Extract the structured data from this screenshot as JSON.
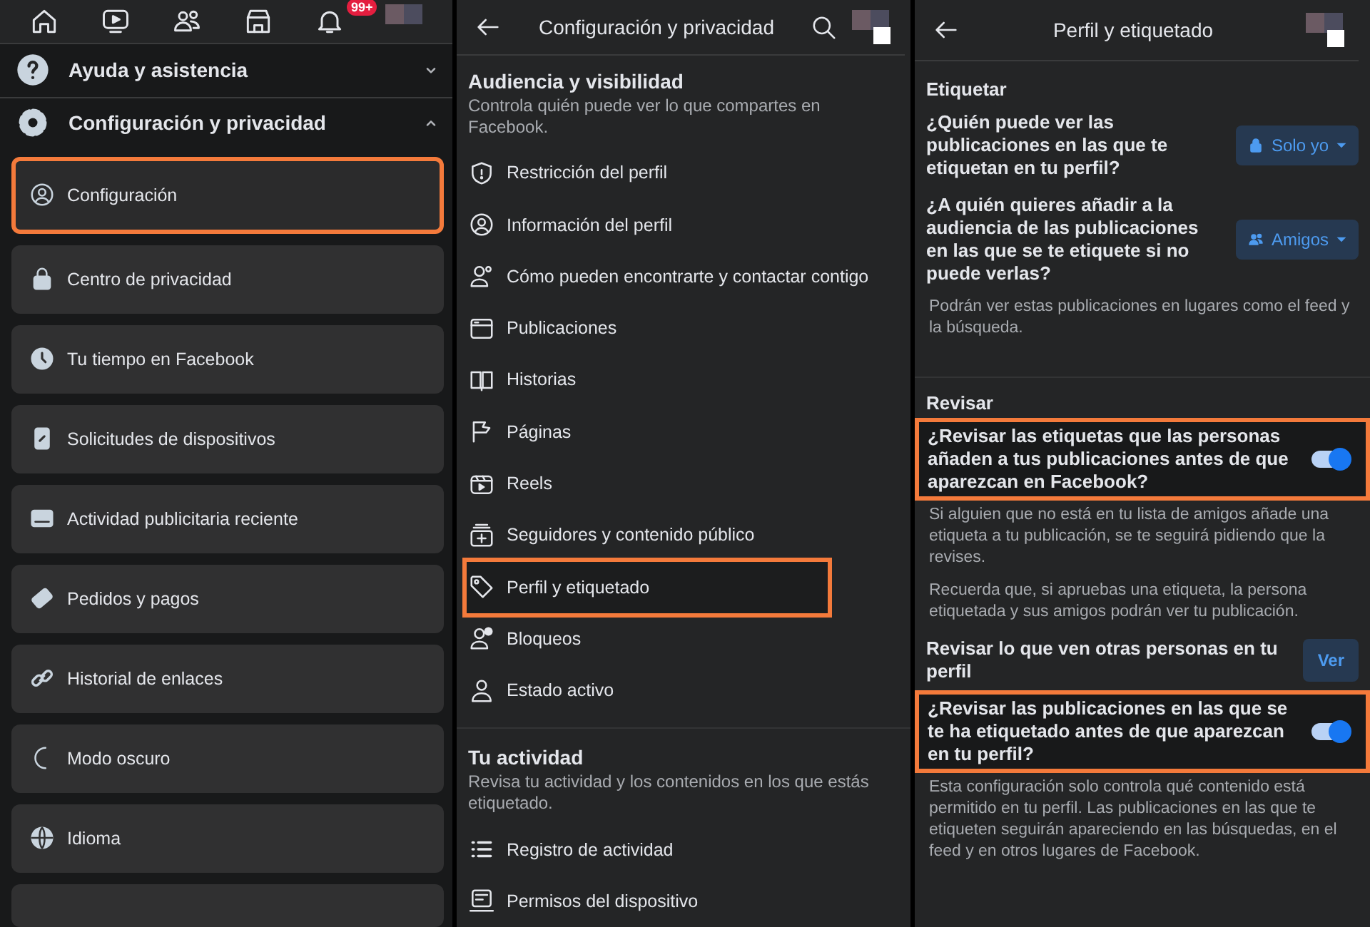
{
  "menu_screen": {
    "nav_tabs": [
      {
        "kind": "home"
      },
      {
        "kind": "video"
      },
      {
        "kind": "friends"
      },
      {
        "kind": "store"
      },
      {
        "kind": "bell",
        "badge": "99+"
      },
      {
        "kind": "avatar"
      }
    ],
    "sections": [
      {
        "kind": "question",
        "label": "Ayuda y asistencia",
        "expanded": false
      },
      {
        "kind": "gear",
        "label": "Configuración y privacidad",
        "expanded": true
      }
    ],
    "items": [
      {
        "kind": "user-circle",
        "label": "Configuración",
        "highlighted": true
      },
      {
        "kind": "lock",
        "label": "Centro de privacidad",
        "highlighted": false
      },
      {
        "kind": "clock",
        "label": "Tu tiempo en Facebook",
        "highlighted": false
      },
      {
        "kind": "phone",
        "label": "Solicitudes de dispositivos",
        "highlighted": false
      },
      {
        "kind": "ad",
        "label": "Actividad publicitaria reciente",
        "highlighted": false
      },
      {
        "kind": "card",
        "label": "Pedidos y pagos",
        "highlighted": false
      },
      {
        "kind": "link",
        "label": "Historial de enlaces",
        "highlighted": false
      },
      {
        "kind": "moon",
        "label": "Modo oscuro",
        "highlighted": false
      },
      {
        "kind": "globe",
        "label": "Idioma",
        "highlighted": false
      }
    ]
  },
  "settings_screen": {
    "title": "Configuración y privacidad",
    "groups": [
      {
        "title": "Audiencia y visibilidad",
        "description": "Controla quién puede ver lo que compartes en Facebook.",
        "items": [
          {
            "kind": "shield",
            "label": "Restricción del perfil",
            "highlighted": false
          },
          {
            "kind": "user-circle",
            "label": "Información del perfil",
            "highlighted": false
          },
          {
            "kind": "user-search",
            "label": "Cómo pueden encontrarte y contactar contigo",
            "highlighted": false
          },
          {
            "kind": "window",
            "label": "Publicaciones",
            "highlighted": false
          },
          {
            "kind": "book",
            "label": "Historias",
            "highlighted": false
          },
          {
            "kind": "flag",
            "label": "Páginas",
            "highlighted": false
          },
          {
            "kind": "play",
            "label": "Reels",
            "highlighted": false
          },
          {
            "kind": "plus-box",
            "label": "Seguidores y contenido público",
            "highlighted": false
          },
          {
            "kind": "tag",
            "label": "Perfil y etiquetado",
            "highlighted": true
          },
          {
            "kind": "user-block",
            "label": "Bloqueos",
            "highlighted": false
          },
          {
            "kind": "person",
            "label": "Estado activo",
            "highlighted": false
          }
        ]
      },
      {
        "title": "Tu actividad",
        "description": "Revisa tu actividad y los contenidos en los que estás etiquetado.",
        "items": [
          {
            "kind": "list",
            "label": "Registro de actividad",
            "highlighted": false
          },
          {
            "kind": "device",
            "label": "Permisos del dispositivo",
            "highlighted": false
          }
        ]
      }
    ]
  },
  "tagging_screen": {
    "title": "Perfil y etiquetado",
    "sections": [
      {
        "title": "Etiquetar",
        "rows": [
          {
            "kind": "dropdown",
            "question": "¿Quién puede ver las publicaciones en las que te etiquetan en tu perfil?",
            "value": "Solo yo"
          },
          {
            "kind": "dropdown",
            "question": "¿A quién quieres añadir a la audiencia de las publicaciones en las que se te etiquete si no puede verlas?",
            "value": "Amigos"
          },
          {
            "kind": "note",
            "text": "Podrán ver estas publicaciones en lugares como el feed y la búsqueda."
          }
        ]
      },
      {
        "title": "Revisar",
        "rows": [
          {
            "kind": "toggle",
            "question": "¿Revisar las etiquetas que las personas añaden a tus publicaciones antes de que aparezcan en Facebook?",
            "on": true,
            "highlighted": true
          },
          {
            "kind": "note",
            "text": "Si alguien que no está en tu lista de amigos añade una etiqueta a tu publicación, se te seguirá pidiendo que la revises."
          },
          {
            "kind": "note",
            "text": "Recuerda que, si apruebas una etiqueta, la persona etiquetada y sus amigos podrán ver tu publicación."
          },
          {
            "kind": "button",
            "question": "Revisar lo que ven otras personas en tu perfil",
            "value": "Ver"
          },
          {
            "kind": "toggle",
            "question": "¿Revisar las publicaciones en las que se te ha etiquetado antes de que aparezcan en tu perfil?",
            "on": true,
            "highlighted": true
          },
          {
            "kind": "note",
            "text": "Esta configuración solo controla qué contenido está permitido en tu perfil. Las publicaciones en las que te etiqueten seguirán apareciendo en las búsquedas, en el feed y en otros lugares de Facebook."
          }
        ]
      }
    ]
  }
}
